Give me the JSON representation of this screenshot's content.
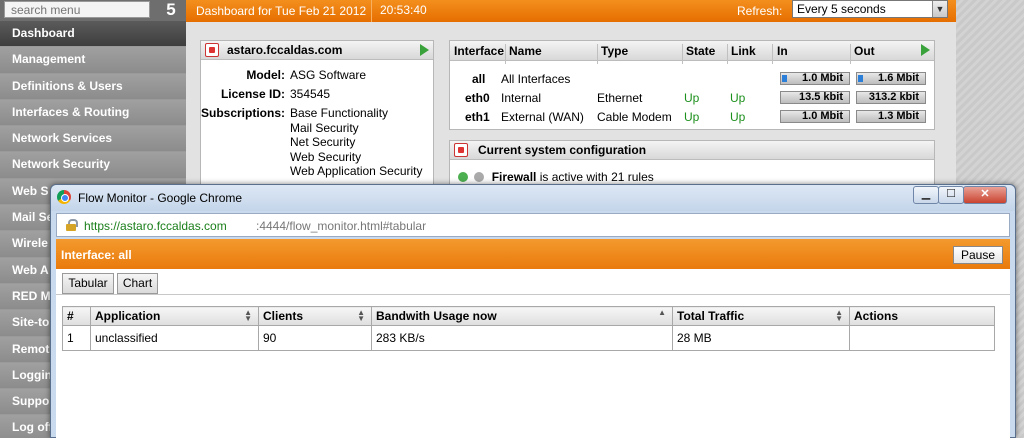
{
  "sidebar": {
    "search_placeholder": "search menu",
    "logo_glyph": "5",
    "items": [
      {
        "label": "Dashboard"
      },
      {
        "label": "Management"
      },
      {
        "label": "Definitions & Users"
      },
      {
        "label": "Interfaces & Routing"
      },
      {
        "label": "Network Services"
      },
      {
        "label": "Network Security"
      },
      {
        "label": "Web S"
      },
      {
        "label": "Mail Se"
      },
      {
        "label": "Wirele"
      },
      {
        "label": "Web A"
      },
      {
        "label": "RED M"
      },
      {
        "label": "Site-to"
      },
      {
        "label": "Remot"
      },
      {
        "label": "Loggin"
      },
      {
        "label": "Suppo"
      },
      {
        "label": "Log off"
      }
    ]
  },
  "dashboard": {
    "title": "Dashboard for Tue Feb 21 2012",
    "time": "20:53:40",
    "refresh_label": "Refresh:",
    "refresh_value": "Every 5 seconds",
    "host": {
      "name": "astaro.fccaldas.com",
      "model_key": "Model:",
      "model_val": "ASG Software",
      "license_key": "License ID:",
      "license_val": "354545",
      "subs_key": "Subscriptions:",
      "subscriptions": [
        "Base Functionality",
        "Mail Security",
        "Net Security",
        "Web Security",
        "Web Application Security"
      ]
    },
    "interfaces": {
      "headers": {
        "iface": "Interface",
        "name": "Name",
        "type": "Type",
        "state": "State",
        "link": "Link",
        "in": "In",
        "out": "Out"
      },
      "rows": [
        {
          "iface": "all",
          "name": "All Interfaces",
          "type": "",
          "state": "",
          "link": "",
          "in": "1.0 Mbit",
          "out": "1.6 Mbit"
        },
        {
          "iface": "eth0",
          "name": "Internal",
          "type": "Ethernet",
          "state": "Up",
          "link": "Up",
          "in": "13.5 kbit",
          "out": "313.2 kbit"
        },
        {
          "iface": "eth1",
          "name": "External (WAN)",
          "type": "Cable Modem",
          "state": "Up",
          "link": "Up",
          "in": "1.0 Mbit",
          "out": "1.3 Mbit"
        }
      ]
    },
    "config": {
      "title": "Current system configuration",
      "firewall_bold": "Firewall",
      "firewall_rest": " is active with 21 rules"
    }
  },
  "popup": {
    "window_title": "Flow Monitor - Google Chrome",
    "url_host": "https://astaro.fccaldas.com",
    "url_rest": ":4444/flow_monitor.html#tabular",
    "interface_label": "Interface: all",
    "pause_label": "Pause",
    "tabs": {
      "tabular": "Tabular",
      "chart": "Chart"
    },
    "table": {
      "headers": [
        "#",
        "Application",
        "Clients",
        "Bandwith Usage now",
        "Total Traffic",
        "Actions"
      ],
      "rows": [
        [
          "1",
          "unclassified",
          "90",
          "283 KB/s",
          "28 MB",
          ""
        ]
      ]
    }
  }
}
